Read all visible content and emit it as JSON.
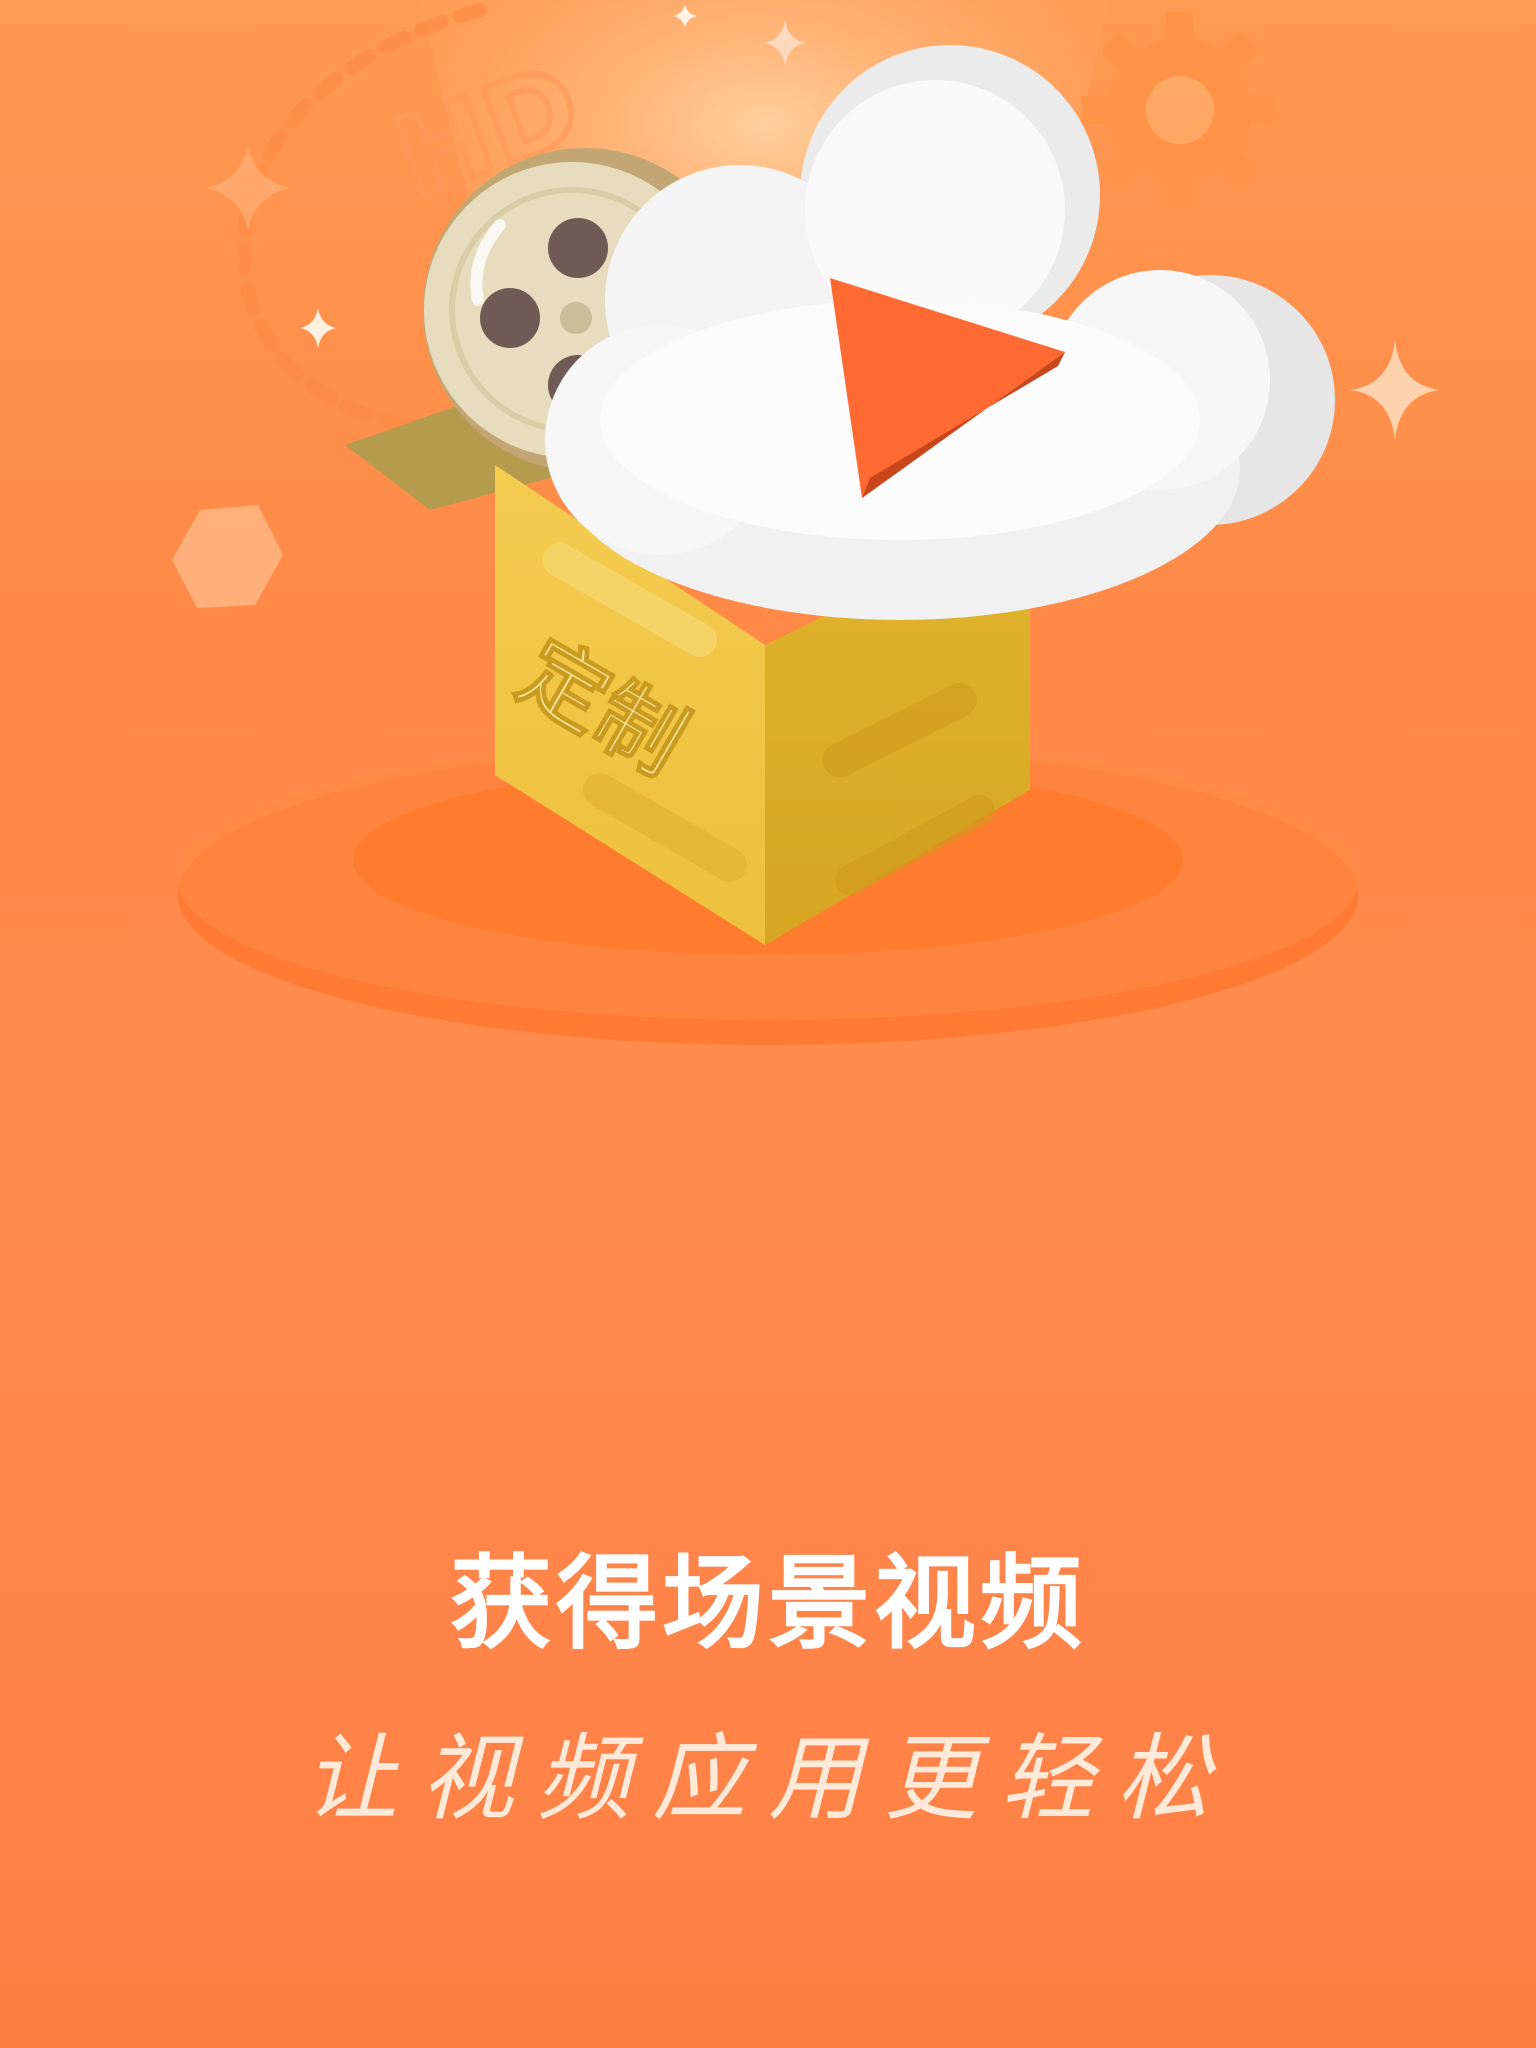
{
  "illustration": {
    "box_label": "定制",
    "badge_text": "HD",
    "icons": [
      "film-reel-icon",
      "cloud-icon",
      "play-icon",
      "gear-icon",
      "sparkle-icon",
      "hexagon-icon",
      "gift-box-icon"
    ]
  },
  "headline": "获得场景视频",
  "tagline": "让视频应用更轻松",
  "colors": {
    "background_top": "#ff9a52",
    "background_bottom": "#ff7e42",
    "box_yellow": "#f0c53a",
    "play_orange": "#ff6a33",
    "text_white": "#ffffff"
  }
}
